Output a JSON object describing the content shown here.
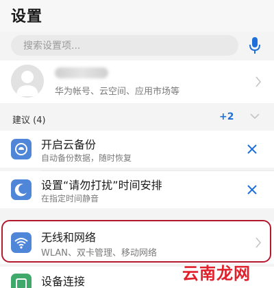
{
  "header": {
    "title": "设置"
  },
  "search": {
    "placeholder": "搜索设置项..."
  },
  "account": {
    "subtitle": "华为帐号、云空间、应用市场等"
  },
  "suggestions": {
    "title": "建议 (4)",
    "more_count": "+2",
    "items": [
      {
        "title": "开启云备份",
        "subtitle": "自动备份数据，随时恢复",
        "icon": "cloud-backup-icon"
      },
      {
        "title": "设置“请勿打扰”时间安排",
        "subtitle": "在指定时间静音",
        "icon": "moon-icon"
      }
    ]
  },
  "settings": {
    "items": [
      {
        "title": "无线和网络",
        "subtitle": "WLAN、双卡管理、移动网络",
        "icon": "wifi-icon"
      },
      {
        "title": "设备连接",
        "subtitle": "",
        "icon": "device-connection-icon"
      }
    ]
  },
  "watermark": {
    "text": "云南龙网"
  },
  "colors": {
    "accent": "#1e6fd9",
    "icon_bg": "#4f86d8",
    "highlight": "#b4182d",
    "watermark": "#e0202b"
  }
}
